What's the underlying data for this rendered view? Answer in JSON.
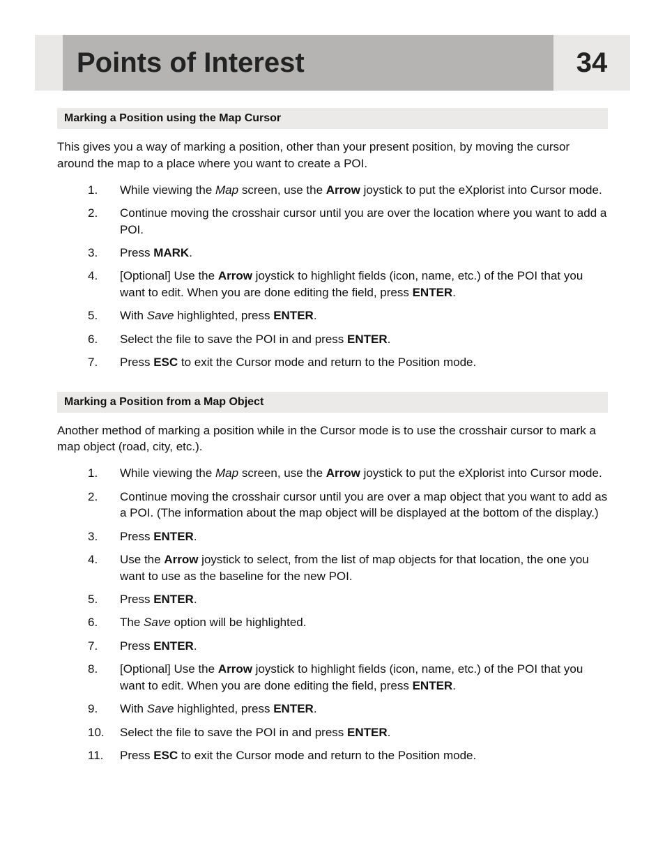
{
  "header": {
    "title": "Points of Interest",
    "page_number": "34"
  },
  "sections": [
    {
      "heading": "Marking a Position using the Map Cursor",
      "intro": "This gives you a way of marking a position, other than your present position, by moving the cursor around the map to a place where you want to create a POI.",
      "steps": [
        {
          "num": "1.",
          "parts": [
            {
              "t": "While viewing the "
            },
            {
              "t": "Map",
              "style": "i"
            },
            {
              "t": " screen, use the "
            },
            {
              "t": "Arrow",
              "style": "b"
            },
            {
              "t": " joystick to put the eXplorist into Cursor mode."
            }
          ]
        },
        {
          "num": "2.",
          "parts": [
            {
              "t": "Continue moving the crosshair cursor until you are over the location where you want to add a POI."
            }
          ]
        },
        {
          "num": "3.",
          "parts": [
            {
              "t": "Press "
            },
            {
              "t": "MARK",
              "style": "b"
            },
            {
              "t": "."
            }
          ]
        },
        {
          "num": "4.",
          "parts": [
            {
              "t": "[Optional]  Use the "
            },
            {
              "t": "Arrow",
              "style": "b"
            },
            {
              "t": " joystick to highlight fields (icon, name, etc.) of the POI that you want to edit.  When you are done editing the field, press "
            },
            {
              "t": "ENTER",
              "style": "b"
            },
            {
              "t": "."
            }
          ]
        },
        {
          "num": "5.",
          "parts": [
            {
              "t": "With "
            },
            {
              "t": "Save",
              "style": "i"
            },
            {
              "t": " highlighted, press "
            },
            {
              "t": "ENTER",
              "style": "b"
            },
            {
              "t": "."
            }
          ]
        },
        {
          "num": "6.",
          "parts": [
            {
              "t": "Select the file to save the POI in and press "
            },
            {
              "t": "ENTER",
              "style": "b"
            },
            {
              "t": "."
            }
          ]
        },
        {
          "num": "7.",
          "parts": [
            {
              "t": "Press "
            },
            {
              "t": "ESC",
              "style": "b"
            },
            {
              "t": " to exit the Cursor mode and return to the Position mode."
            }
          ]
        }
      ]
    },
    {
      "heading": "Marking a Position from a Map Object",
      "intro": "Another method of marking a position while in the Cursor mode is to use the crosshair cursor to mark a map object (road, city, etc.).",
      "steps": [
        {
          "num": "1.",
          "parts": [
            {
              "t": "While viewing the "
            },
            {
              "t": "Map",
              "style": "i"
            },
            {
              "t": " screen, use the "
            },
            {
              "t": "Arrow",
              "style": "b"
            },
            {
              "t": " joystick to put the eXplorist into Cursor mode."
            }
          ]
        },
        {
          "num": "2.",
          "parts": [
            {
              "t": "Continue moving the crosshair cursor until you are over a map object that you want to add as a POI. (The information about the map object will be displayed at the bottom of the display.)"
            }
          ]
        },
        {
          "num": "3.",
          "parts": [
            {
              "t": "Press "
            },
            {
              "t": "ENTER",
              "style": "b"
            },
            {
              "t": "."
            }
          ]
        },
        {
          "num": "4.",
          "parts": [
            {
              "t": "Use the "
            },
            {
              "t": "Arrow",
              "style": "b"
            },
            {
              "t": " joystick to select, from the list of map objects for that location, the one you want to use as the baseline for the new POI."
            }
          ]
        },
        {
          "num": "5.",
          "parts": [
            {
              "t": "Press "
            },
            {
              "t": "ENTER",
              "style": "b"
            },
            {
              "t": "."
            }
          ]
        },
        {
          "num": "6.",
          "parts": [
            {
              "t": "The "
            },
            {
              "t": "Save",
              "style": "i"
            },
            {
              "t": " option will be highlighted."
            }
          ]
        },
        {
          "num": "7.",
          "parts": [
            {
              "t": "Press "
            },
            {
              "t": "ENTER",
              "style": "b"
            },
            {
              "t": "."
            }
          ]
        },
        {
          "num": "8.",
          "parts": [
            {
              "t": "[Optional]  Use the "
            },
            {
              "t": "Arrow",
              "style": "b"
            },
            {
              "t": " joystick to highlight fields (icon, name, etc.) of the POI that you want to edit.  When you are done editing the field, press "
            },
            {
              "t": "ENTER",
              "style": "b"
            },
            {
              "t": "."
            }
          ]
        },
        {
          "num": "9.",
          "parts": [
            {
              "t": "With "
            },
            {
              "t": "Save",
              "style": "i"
            },
            {
              "t": " highlighted, press "
            },
            {
              "t": "ENTER",
              "style": "b"
            },
            {
              "t": "."
            }
          ]
        },
        {
          "num": "10.",
          "parts": [
            {
              "t": "Select the file to save the POI in and press "
            },
            {
              "t": "ENTER",
              "style": "b"
            },
            {
              "t": "."
            }
          ]
        },
        {
          "num": "11.",
          "parts": [
            {
              "t": "Press "
            },
            {
              "t": "ESC",
              "style": "b"
            },
            {
              "t": " to exit the Cursor mode and return to the Position mode."
            }
          ]
        }
      ]
    }
  ]
}
